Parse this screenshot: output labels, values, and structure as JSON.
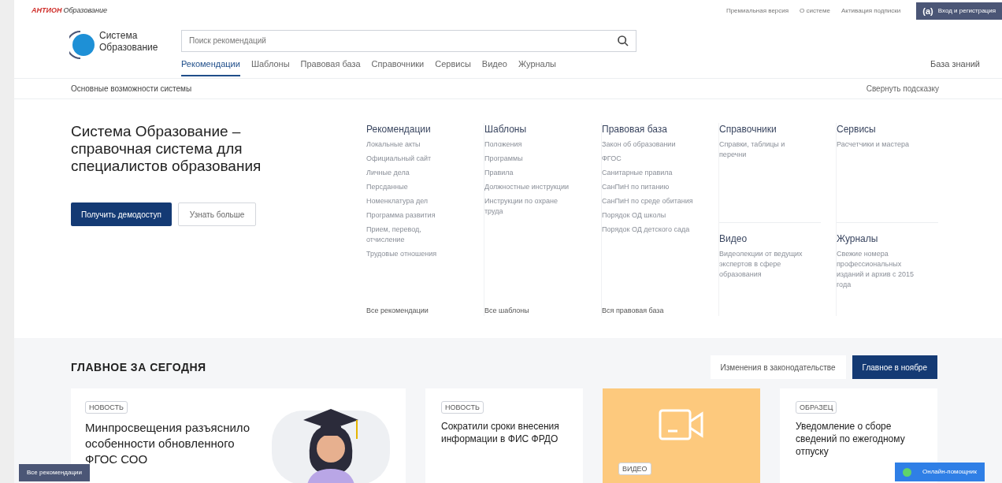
{
  "top_bar": {
    "brand": "АНТИОН",
    "brand_sub": "Образование",
    "links": [
      "Премиальная версия",
      "О системе",
      "Активация подписки"
    ],
    "login_button": {
      "icon_text": "(а)",
      "label": "Вход и регистрация"
    }
  },
  "header": {
    "logo_text": [
      "Система",
      "Образование"
    ],
    "search": {
      "placeholder": "Поиск рекомендаций"
    },
    "tabs": [
      {
        "label": "Рекомендации",
        "selected": true
      },
      {
        "label": "Шаблоны",
        "selected": false
      },
      {
        "label": "Правовая база",
        "selected": false
      },
      {
        "label": "Справочники",
        "selected": false
      },
      {
        "label": "Сервисы",
        "selected": false
      },
      {
        "label": "Видео",
        "selected": false
      },
      {
        "label": "Журналы",
        "selected": false
      }
    ],
    "knowledge_link": "База знаний"
  },
  "hint_bar": {
    "title": "Основные возможности системы",
    "collapse_link": "Свернуть подсказку"
  },
  "hero": {
    "title": "Система Образование – справочная система для специалистов образования",
    "primary_button": "Получить демодоступ",
    "secondary_button": "Узнать больше",
    "columns": [
      {
        "blocks": [
          {
            "title": "Рекомендации",
            "items": [
              "Локальные акты",
              "Официальный сайт",
              "Личные дела",
              "Персданные",
              "Номенклатура дел",
              "Программа развития",
              "Прием, перевод, отчисление",
              "Трудовые отношения"
            ]
          }
        ],
        "footer": "Все рекомендации"
      },
      {
        "blocks": [
          {
            "title": "Шаблоны",
            "items": [
              "Положения",
              "Программы",
              "Правила",
              "Должностные инструкции",
              "Инструкции по охране труда"
            ]
          }
        ],
        "footer": "Все шаблоны"
      },
      {
        "blocks": [
          {
            "title": "Правовая база",
            "items": [
              "Закон об образовании",
              "ФГОС",
              "Санитарные правила",
              "СанПиН по питанию",
              "СанПиН по среде обитания",
              "Порядок ОД школы",
              "Порядок ОД детского сада"
            ]
          }
        ],
        "footer": "Вся правовая база"
      },
      {
        "blocks": [
          {
            "title": "Справочники",
            "items": [
              "Справки, таблицы и перечни"
            ]
          },
          {
            "title": "Видео",
            "items": [
              "Видеолекции от ведущих экспертов в сфере образования"
            ]
          }
        ]
      },
      {
        "blocks": [
          {
            "title": "Сервисы",
            "items": [
              "Расчетчики и мастера"
            ]
          },
          {
            "title": "Журналы",
            "items": [
              "Свежие номера профессиональных изданий и архив с 2015 года"
            ]
          }
        ]
      }
    ]
  },
  "today": {
    "heading": "ГЛАВНОЕ ЗА СЕГОДНЯ",
    "filters": [
      {
        "label": "Изменения в законодательстве",
        "selected": false
      },
      {
        "label": "Главное в ноябре",
        "selected": true
      }
    ],
    "cards": [
      {
        "kind": "wide",
        "tag": "НОВОСТЬ",
        "title": "Минпросвещения разъяснило особенности обновленного ФГОС СОО"
      },
      {
        "kind": "text",
        "tag": "НОВОСТЬ",
        "title": "Сократили сроки внесения информации в ФИС ФРДО"
      },
      {
        "kind": "video",
        "tag": "ВИДЕО"
      },
      {
        "kind": "text",
        "tag": "ОБРАЗЕЦ",
        "title": "Уведомление о сборе сведений по ежегодному отпуску"
      }
    ]
  },
  "floating": {
    "all_recommendations": "Все рекомендации",
    "assistant": "Онлайн-помощник"
  }
}
